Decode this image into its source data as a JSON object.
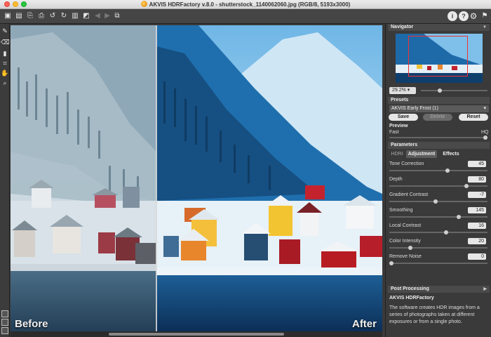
{
  "window": {
    "title": "AKVIS HDRFactory v.8.0 - shutterstock_1140062060.jpg (RGB/8, 5193x3000)"
  },
  "toolbar": {
    "left_icons": [
      "open-image-icon",
      "open-folder-icon",
      "save-icon",
      "print-icon",
      "undo-icon",
      "redo-icon",
      "batch-icon",
      "back-icon",
      "forward-icon",
      "selection-icon"
    ],
    "right_icons": [
      {
        "name": "info-icon",
        "glyph": "i"
      },
      {
        "name": "help-icon",
        "glyph": "?"
      },
      {
        "name": "settings-icon",
        "glyph": "⚙"
      },
      {
        "name": "news-icon",
        "glyph": "⚑"
      }
    ]
  },
  "tools": [
    "brush-tool-icon",
    "eraser-tool-icon",
    "gradient-tool-icon",
    "crop-tool-icon",
    "hand-tool-icon",
    "zoom-tool-icon"
  ],
  "canvas": {
    "before_label": "Before",
    "after_label": "After"
  },
  "navigator": {
    "title": "Navigator",
    "zoom": "29.2%"
  },
  "presets": {
    "title": "Presets",
    "selected": "AKVIS Early Frost (1)",
    "save_label": "Save",
    "delete_label": "Delete",
    "reset_label": "Reset"
  },
  "preview": {
    "title": "Preview",
    "fast_label": "Fast",
    "hq_label": "HQ"
  },
  "parameters": {
    "title": "Parameters",
    "tabs": [
      {
        "label": "HDRI",
        "state": "disabled"
      },
      {
        "label": "Adjustment",
        "state": "active"
      },
      {
        "label": "Effects",
        "state": "normal"
      }
    ],
    "items": [
      {
        "label": "Tone Correction",
        "value": "45",
        "fraction": 0.6
      },
      {
        "label": "Depth",
        "value": "80",
        "fraction": 0.8
      },
      {
        "label": "Gradient Contrast",
        "value": "-7",
        "fraction": 0.47
      },
      {
        "label": "Smoothing",
        "value": "145",
        "fraction": 0.72
      },
      {
        "label": "Local Contrast",
        "value": "16",
        "fraction": 0.58
      },
      {
        "label": "Color Intensity",
        "value": "20",
        "fraction": 0.2
      },
      {
        "label": "Remove Noise",
        "value": "0",
        "fraction": 0.0
      }
    ]
  },
  "post_processing": {
    "title": "Post Processing"
  },
  "help": {
    "title": "AKVIS HDRFactory",
    "text": "The software creates HDR images from a series of photographs taken at different exposures or from a single photo."
  }
}
